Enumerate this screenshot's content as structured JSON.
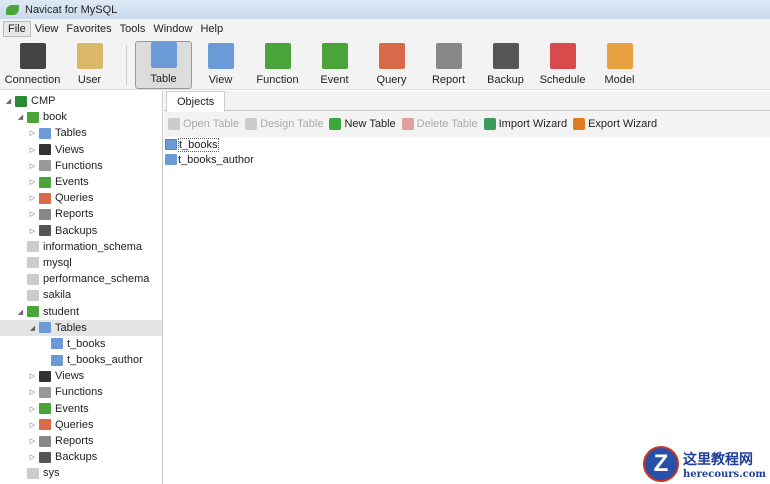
{
  "window": {
    "title": "Navicat for MySQL"
  },
  "menu": [
    "File",
    "View",
    "Favorites",
    "Tools",
    "Window",
    "Help"
  ],
  "toolbar": [
    {
      "label": "Connection",
      "icon": "connection-icon",
      "color": "#444"
    },
    {
      "label": "User",
      "icon": "user-icon",
      "color": "#d9b86a"
    },
    {
      "label": "Table",
      "icon": "table-icon",
      "color": "#6b9bd6",
      "selected": true
    },
    {
      "label": "View",
      "icon": "view-icon",
      "color": "#6b9bd6"
    },
    {
      "label": "Function",
      "icon": "function-icon",
      "color": "#4aa43a"
    },
    {
      "label": "Event",
      "icon": "event-icon",
      "color": "#4aa43a"
    },
    {
      "label": "Query",
      "icon": "query-icon",
      "color": "#d96b4a"
    },
    {
      "label": "Report",
      "icon": "report-icon",
      "color": "#888"
    },
    {
      "label": "Backup",
      "icon": "backup-icon",
      "color": "#555"
    },
    {
      "label": "Schedule",
      "icon": "schedule-icon",
      "color": "#d94a4a"
    },
    {
      "label": "Model",
      "icon": "model-icon",
      "color": "#e8a040"
    }
  ],
  "tree": [
    {
      "label": "CMP",
      "level": 0,
      "arrow": "open",
      "icon": "connection-icon",
      "color": "#2a8a3a"
    },
    {
      "label": "book",
      "level": 1,
      "arrow": "open",
      "icon": "database-icon",
      "color": "#4aa43a"
    },
    {
      "label": "Tables",
      "level": 2,
      "arrow": "closed",
      "icon": "table-icon",
      "color": "#6b9bd6"
    },
    {
      "label": "Views",
      "level": 2,
      "arrow": "closed",
      "icon": "view-icon",
      "color": "#333"
    },
    {
      "label": "Functions",
      "level": 2,
      "arrow": "closed",
      "icon": "function-icon",
      "color": "#999"
    },
    {
      "label": "Events",
      "level": 2,
      "arrow": "closed",
      "icon": "event-icon",
      "color": "#4aa43a"
    },
    {
      "label": "Queries",
      "level": 2,
      "arrow": "closed",
      "icon": "query-icon",
      "color": "#d96b4a"
    },
    {
      "label": "Reports",
      "level": 2,
      "arrow": "closed",
      "icon": "report-icon",
      "color": "#888"
    },
    {
      "label": "Backups",
      "level": 2,
      "arrow": "closed",
      "icon": "backup-icon",
      "color": "#555"
    },
    {
      "label": "information_schema",
      "level": 1,
      "icon": "database-icon",
      "color": "#ccc"
    },
    {
      "label": "mysql",
      "level": 1,
      "icon": "database-icon",
      "color": "#ccc"
    },
    {
      "label": "performance_schema",
      "level": 1,
      "icon": "database-icon",
      "color": "#ccc"
    },
    {
      "label": "sakila",
      "level": 1,
      "icon": "database-icon",
      "color": "#ccc"
    },
    {
      "label": "student",
      "level": 1,
      "arrow": "open",
      "icon": "database-icon",
      "color": "#4aa43a"
    },
    {
      "label": "Tables",
      "level": 2,
      "arrow": "open",
      "icon": "table-icon",
      "color": "#6b9bd6",
      "selected": true
    },
    {
      "label": "t_books",
      "level": 3,
      "icon": "table-icon",
      "color": "#6b9bd6"
    },
    {
      "label": "t_books_author",
      "level": 3,
      "icon": "table-icon",
      "color": "#6b9bd6"
    },
    {
      "label": "Views",
      "level": 2,
      "arrow": "closed",
      "icon": "view-icon",
      "color": "#333"
    },
    {
      "label": "Functions",
      "level": 2,
      "arrow": "closed",
      "icon": "function-icon",
      "color": "#999"
    },
    {
      "label": "Events",
      "level": 2,
      "arrow": "closed",
      "icon": "event-icon",
      "color": "#4aa43a"
    },
    {
      "label": "Queries",
      "level": 2,
      "arrow": "closed",
      "icon": "query-icon",
      "color": "#d96b4a"
    },
    {
      "label": "Reports",
      "level": 2,
      "arrow": "closed",
      "icon": "report-icon",
      "color": "#888"
    },
    {
      "label": "Backups",
      "level": 2,
      "arrow": "closed",
      "icon": "backup-icon",
      "color": "#555"
    },
    {
      "label": "sys",
      "level": 1,
      "icon": "database-icon",
      "color": "#ccc"
    }
  ],
  "main": {
    "tab": "Objects",
    "actions": [
      {
        "label": "Open Table",
        "icon": "open-table-icon",
        "disabled": true,
        "color": "#ccc"
      },
      {
        "label": "Design Table",
        "icon": "design-table-icon",
        "disabled": true,
        "color": "#ccc"
      },
      {
        "label": "New Table",
        "icon": "new-table-icon",
        "color": "#3aa83a"
      },
      {
        "label": "Delete Table",
        "icon": "delete-table-icon",
        "disabled": true,
        "color": "#e0a0a0"
      },
      {
        "label": "Import Wizard",
        "icon": "import-wizard-icon",
        "color": "#3a9a5a"
      },
      {
        "label": "Export Wizard",
        "icon": "export-wizard-icon",
        "color": "#e07a20"
      }
    ],
    "objects": [
      {
        "label": "t_books",
        "selected": true
      },
      {
        "label": "t_books_author"
      }
    ]
  },
  "watermark": {
    "title": "这里教程网",
    "url": "herecours.com",
    "letter": "Z"
  }
}
